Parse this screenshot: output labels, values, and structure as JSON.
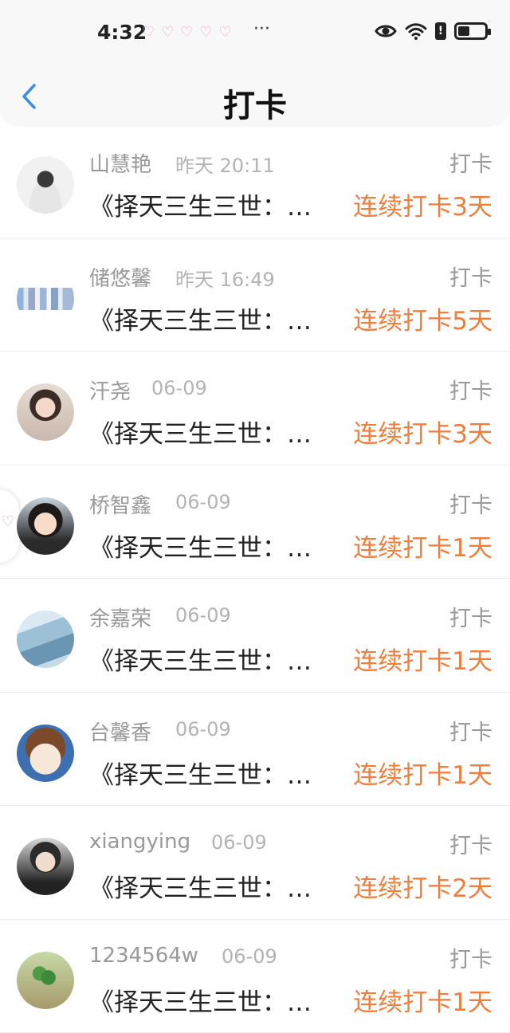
{
  "status_bar": {
    "time": "4:32",
    "hearts": "♡♡♡♡♡",
    "more": "···",
    "icons": [
      "eye-icon",
      "wifi-icon",
      "alert-icon",
      "battery-icon"
    ]
  },
  "header": {
    "back_icon": "chevron-left-icon",
    "title": "打卡"
  },
  "colors": {
    "accent": "#ef7d3c",
    "back_icon": "#3a8ee6",
    "name": "#999999"
  },
  "list": {
    "rows": [
      {
        "name": "山慧艳",
        "time": "昨天 20:11",
        "tag": "打卡",
        "content": "《择天三生三世：…",
        "streak": "连续打卡3天"
      },
      {
        "name": "储悠馨",
        "time": "昨天 16:49",
        "tag": "打卡",
        "content": "《择天三生三世：…",
        "streak": "连续打卡5天"
      },
      {
        "name": "汗尧",
        "time": "06-09",
        "tag": "打卡",
        "content": "《择天三生三世：…",
        "streak": "连续打卡3天"
      },
      {
        "name": "桥智鑫",
        "time": "06-09",
        "tag": "打卡",
        "content": "《择天三生三世：…",
        "streak": "连续打卡1天"
      },
      {
        "name": "余嘉荣",
        "time": "06-09",
        "tag": "打卡",
        "content": "《择天三生三世：…",
        "streak": "连续打卡1天"
      },
      {
        "name": "台馨香",
        "time": "06-09",
        "tag": "打卡",
        "content": "《择天三生三世：…",
        "streak": "连续打卡1天"
      },
      {
        "name": "xiangying",
        "time": "06-09",
        "tag": "打卡",
        "content": "《择天三生三世：…",
        "streak": "连续打卡2天"
      },
      {
        "name": "1234564w",
        "time": "06-09",
        "tag": "打卡",
        "content": "《择天三生三世：…",
        "streak": "连续打卡1天"
      }
    ]
  }
}
